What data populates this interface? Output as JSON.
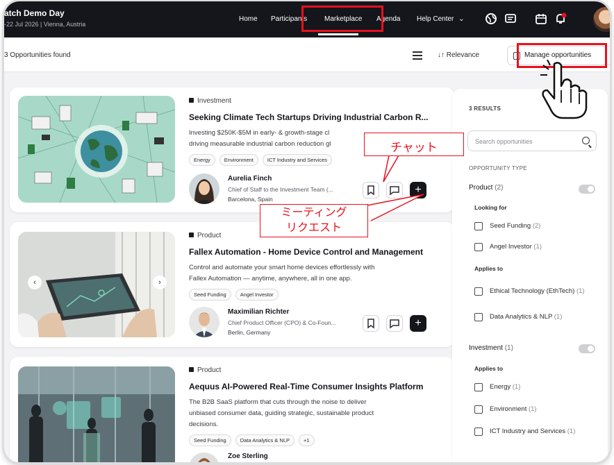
{
  "header": {
    "event_title": "atch Demo Day",
    "event_sub": "-22 Jul 2026 | Vienna, Austria",
    "nav": [
      "Home",
      "Participants",
      "Marketplace",
      "Agenda",
      "Help Center"
    ],
    "icons": [
      "globe-icon",
      "chat-icon",
      "calendar-icon",
      "notification-icon"
    ]
  },
  "results_bar": {
    "found": "3 Opportunities found",
    "sort": "Relevance",
    "manage": "Manage opportunities"
  },
  "cards": [
    {
      "category": "Investment",
      "title": "Seeking Climate Tech Startups Driving Industrial Carbon R...",
      "desc_lines": [
        "Investing $250K-$5M in early- & growth-stage cl",
        "driving measurable industrial carbon reduction gl"
      ],
      "tags": [
        "Energy",
        "Environment",
        "ICT Industry and Services"
      ],
      "person": {
        "name": "Aurelia Finch",
        "role": "Chief of Staff to the Investment Team (...",
        "location": "Barcelona, Spain"
      }
    },
    {
      "category": "Product",
      "title": "Fallex Automation - Home Device Control and Management",
      "desc_lines": [
        "Control and automate your smart home devices effortlessly with",
        "Fallex Automation — anytime, anywhere, all in one app."
      ],
      "tags": [
        "Seed Funding",
        "Angel Investor"
      ],
      "person": {
        "name": "Maximilian Richter",
        "role": "Chief Product Officer (CPO) & Co-Foun...",
        "location": "Berlin, Germany"
      }
    },
    {
      "category": "Product",
      "title": "Aequus AI-Powered Real-Time Consumer Insights Platform",
      "desc_lines": [
        "The B2B SaaS platform that cuts through the noise to deliver",
        "unbiased consumer data, guiding strategic, sustainable product",
        "decisions."
      ],
      "tags": [
        "Seed Funding",
        "Data Analytics & NLP",
        "+1"
      ],
      "person": {
        "name": "Zoe Sterling",
        "role": "",
        "location": ""
      }
    }
  ],
  "filters": {
    "results": "3 RESULTS",
    "search_placeholder": "Search opportunities",
    "type_label": "OPPORTUNITY TYPE",
    "product": {
      "label": "Product",
      "count": "(2)"
    },
    "looking_for": "Looking for",
    "looking_opts": [
      {
        "label": "Seed Funding",
        "count": "(2)"
      },
      {
        "label": "Angel Investor",
        "count": "(1)"
      }
    ],
    "applies_to": "Applies to",
    "product_applies": [
      {
        "label": "Ethical Technology (EthTech)",
        "count": "(1)"
      },
      {
        "label": "Data Analytics & NLP",
        "count": "(1)"
      }
    ],
    "investment": {
      "label": "Investment",
      "count": "(1)"
    },
    "investment_applies_label": "Applies to",
    "investment_applies": [
      {
        "label": "Energy",
        "count": "(1)"
      },
      {
        "label": "Environment",
        "count": "(1)"
      },
      {
        "label": "ICT Industry and Services",
        "count": "(1)"
      }
    ]
  },
  "annotations": {
    "chat": "チャット",
    "meeting_line1": "ミーティング",
    "meeting_line2": "リクエスト",
    "color": "#e8101c"
  }
}
